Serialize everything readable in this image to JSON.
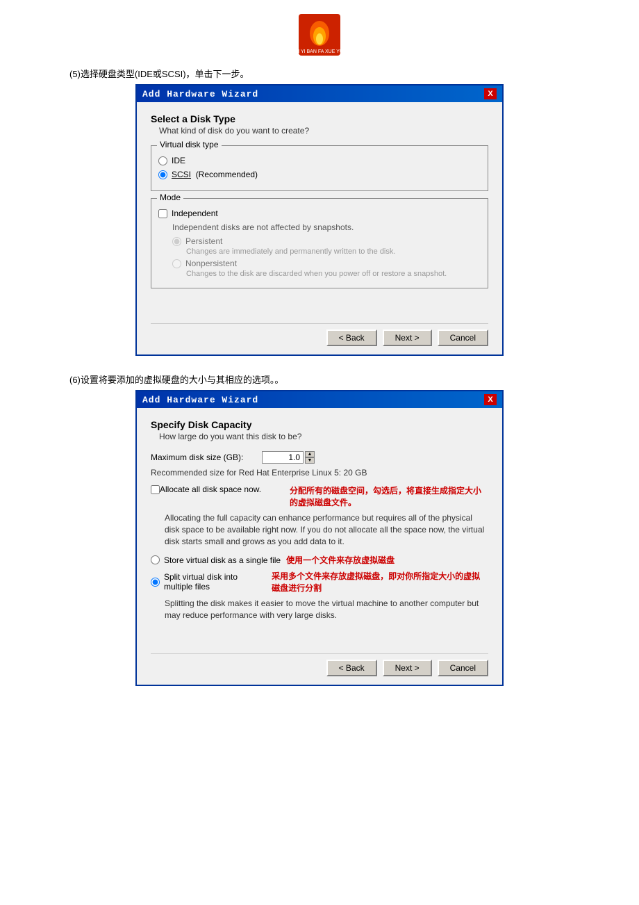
{
  "logo": {
    "alt": "School Logo"
  },
  "step5": {
    "label": "(5)选择硬盘类型(IDE或SCSI)，单击下一步。"
  },
  "step6": {
    "label": "(6)设置将要添加的虚拟硬盘的大小与其相应的选项。。"
  },
  "wizard1": {
    "title": "Add Hardware Wizard",
    "close": "X",
    "header": {
      "title": "Select a Disk Type",
      "subtitle": "What kind of disk do you want to create?"
    },
    "virtual_disk_type": {
      "legend": "Virtual disk type",
      "ide_label": "IDE",
      "scsi_label": "SCSI",
      "recommended": "(Recommended)"
    },
    "mode": {
      "legend": "Mode",
      "independent_label": "Independent",
      "independent_desc": "Independent disks are not affected by snapshots.",
      "persistent_label": "Persistent",
      "persistent_desc": "Changes are immediately and permanently written to the disk.",
      "nonpersistent_label": "Nonpersistent",
      "nonpersistent_desc": "Changes to the disk are discarded when you power off or restore a snapshot."
    },
    "buttons": {
      "back": "< Back",
      "next": "Next >",
      "cancel": "Cancel"
    }
  },
  "wizard2": {
    "title": "Add Hardware Wizard",
    "close": "X",
    "header": {
      "title": "Specify Disk Capacity",
      "subtitle": "How large do you want this disk to be?"
    },
    "max_disk_size": {
      "label": "Maximum disk size (GB):",
      "value": "1.0"
    },
    "recommended": "Recommended size for Red Hat Enterprise Linux 5: 20 GB",
    "allocate": {
      "checkbox_label": "Allocate all disk space now.",
      "note": "分配所有的磁盘空间，勾选后，将直接生成指定大小的虚拟磁盘文件。",
      "desc": "Allocating the full capacity can enhance performance but requires all of the physical disk space to be available right now. If you do not allocate all the space now, the virtual disk starts small and grows as you add data to it."
    },
    "store_single": {
      "label": "Store virtual disk as a single file",
      "note": "使用一个文件来存放虚拟磁盘"
    },
    "split_multiple": {
      "label": "Split virtual disk into multiple files",
      "note": "采用多个文件来存放虚拟磁盘，即对你所指定大小的虚拟磁盘进行分割",
      "desc": "Splitting the disk makes it easier to move the virtual machine to another computer but may reduce performance with very large disks."
    },
    "buttons": {
      "back": "< Back",
      "next": "Next >",
      "cancel": "Cancel"
    }
  }
}
